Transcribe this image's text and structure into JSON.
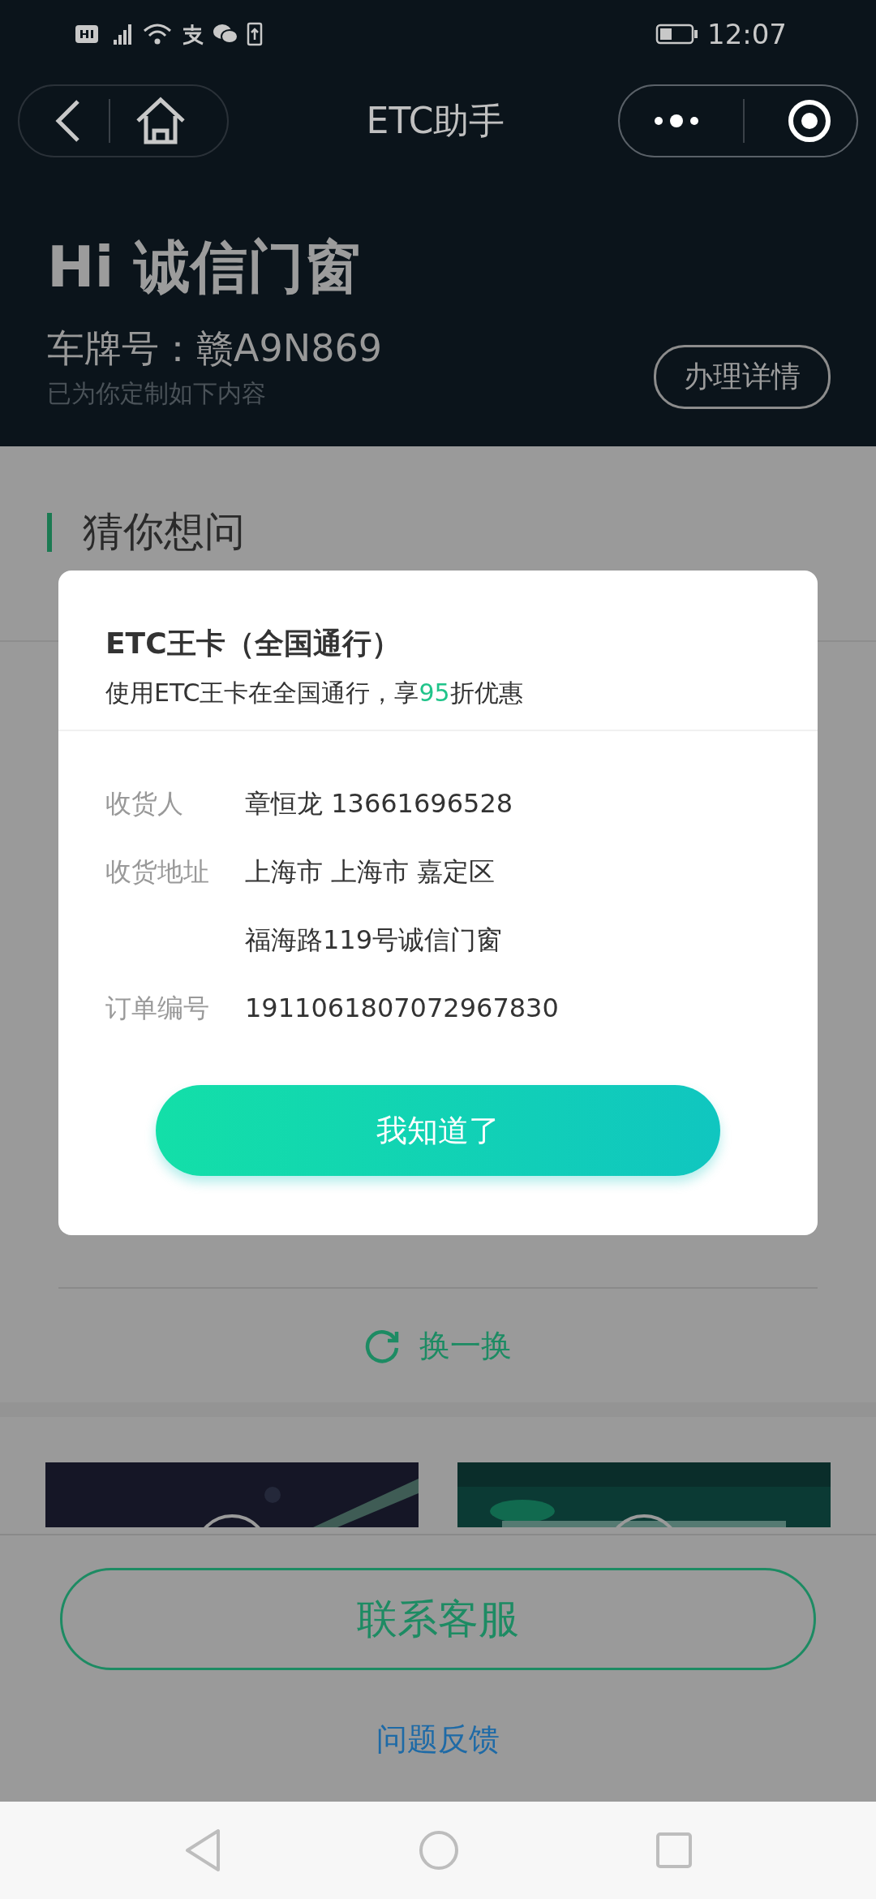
{
  "status_bar": {
    "time": "12:07"
  },
  "nav": {
    "title": "ETC助手"
  },
  "header": {
    "greeting": "Hi 诚信门窗",
    "plate": "车牌号：赣A9N869",
    "subtitle": "已为你定制如下内容",
    "details_button": "办理详情"
  },
  "section": {
    "title": "猜你想问",
    "refresh": "换一换"
  },
  "footer": {
    "contact_button": "联系客服",
    "feedback_link": "问题反馈"
  },
  "dialog": {
    "title": "ETC王卡（全国通行）",
    "subtitle": [
      {
        "text": "使用ETC王卡在全国通行，享",
        "highlight": false
      },
      {
        "text": "95",
        "highlight": true
      },
      {
        "text": "折优惠",
        "highlight": false
      }
    ],
    "fields": [
      {
        "label": "收货人",
        "lines": [
          "章恒龙 13661696528"
        ]
      },
      {
        "label": "收货地址",
        "lines": [
          "上海市 上海市 嘉定区",
          "福海路119号诚信门窗"
        ]
      },
      {
        "label": "订单编号",
        "lines": [
          "1911061807072967830"
        ]
      }
    ],
    "button": "我知道了"
  }
}
